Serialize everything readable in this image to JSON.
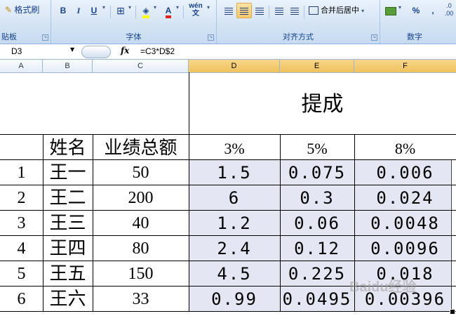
{
  "ribbon": {
    "format_painter_label": "格式刷",
    "bold": "B",
    "italic": "I",
    "underline": "U",
    "phonetic": "wén\n文",
    "merge_center_label": "合并后居中",
    "percent": "%",
    "comma": ",",
    "decimal": ".0\n.00",
    "groups": {
      "clipboard": "贴板",
      "font": "字体",
      "alignment": "对齐方式",
      "number": "数字"
    }
  },
  "formula_bar": {
    "name_box": "D3",
    "fx": "fx",
    "formula": "=C3*D$2"
  },
  "columns": [
    "A",
    "B",
    "C",
    "D",
    "E",
    "F"
  ],
  "sheet": {
    "title": "提成",
    "headers": {
      "name": "姓名",
      "total": "业绩总额",
      "rate1": "3%",
      "rate2": "5%",
      "rate3": "8%"
    },
    "rows": [
      {
        "no": "1",
        "name": "王一",
        "total": "50",
        "d": "1.5",
        "e": "0.075",
        "f": "0.006"
      },
      {
        "no": "2",
        "name": "王二",
        "total": "200",
        "d": "6",
        "e": "0.3",
        "f": "0.024"
      },
      {
        "no": "3",
        "name": "王三",
        "total": "40",
        "d": "1.2",
        "e": "0.06",
        "f": "0.0048"
      },
      {
        "no": "4",
        "name": "王四",
        "total": "80",
        "d": "2.4",
        "e": "0.12",
        "f": "0.0096"
      },
      {
        "no": "5",
        "name": "王五",
        "total": "150",
        "d": "4.5",
        "e": "0.225",
        "f": "0.018"
      },
      {
        "no": "6",
        "name": "王六",
        "total": "33",
        "d": "0.99",
        "e": "0.0495",
        "f": "0.00396"
      }
    ]
  },
  "watermark": "Baidu经验",
  "colors": {
    "selection_fill": "#e4e7f3",
    "selected_column_header": "#f1c15f",
    "ribbon_text": "#15428b"
  }
}
